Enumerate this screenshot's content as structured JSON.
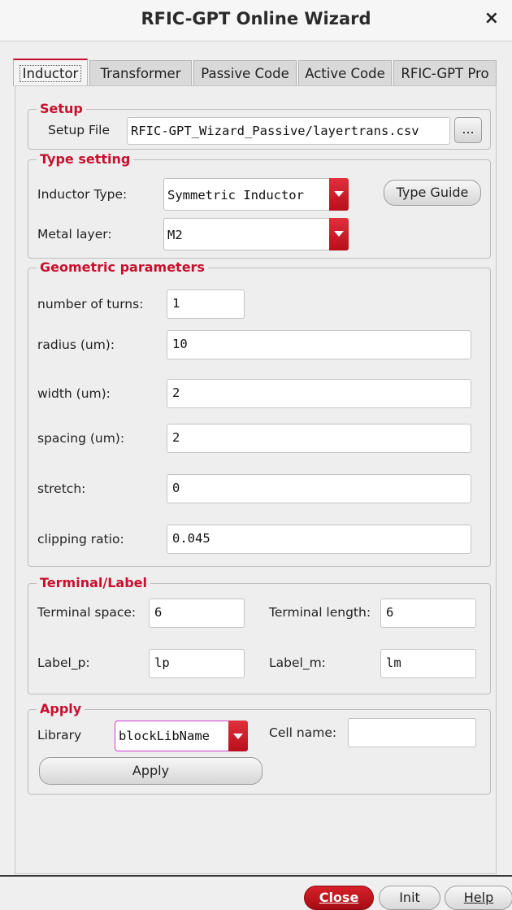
{
  "window": {
    "title": "RFIC-GPT Online Wizard",
    "close_glyph": "×"
  },
  "tabs": [
    {
      "label": "Inductor",
      "active": true
    },
    {
      "label": "Transformer",
      "active": false
    },
    {
      "label": "Passive Code",
      "active": false
    },
    {
      "label": "Active Code",
      "active": false
    },
    {
      "label": "RFIC-GPT Pro",
      "active": false
    }
  ],
  "setup": {
    "title": "Setup",
    "file_label": "Setup File",
    "file_value": "RFIC-GPT_Wizard_Passive/layertrans.csv",
    "browse_label": "..."
  },
  "type_setting": {
    "title": "Type setting",
    "inductor_type_label": "Inductor Type:",
    "inductor_type_value": "Symmetric Inductor",
    "type_guide_label": "Type Guide",
    "metal_layer_label": "Metal layer:",
    "metal_layer_value": "M2"
  },
  "geometric": {
    "title": "Geometric parameters",
    "turns_label": "number of turns:",
    "turns_value": "1",
    "radius_label": "radius (um):",
    "radius_value": "10",
    "width_label": "width (um):",
    "width_value": "2",
    "spacing_label": "spacing (um):",
    "spacing_value": "2",
    "stretch_label": "stretch:",
    "stretch_value": "0",
    "clipping_label": "clipping ratio:",
    "clipping_value": "0.045"
  },
  "terminal": {
    "title": "Terminal/Label",
    "space_label": "Terminal space:",
    "space_value": "6",
    "length_label": "Terminal length:",
    "length_value": "6",
    "label_p_label": "Label_p:",
    "label_p_value": "lp",
    "label_m_label": "Label_m:",
    "label_m_value": "lm"
  },
  "apply": {
    "title": "Apply",
    "library_label": "Library",
    "library_value": "blockLibName",
    "cell_name_label": "Cell name:",
    "cell_name_value": "",
    "apply_label": "Apply"
  },
  "footer": {
    "close_label": "Close",
    "init_label": "Init",
    "help_label": "Help"
  },
  "colors": {
    "accent": "#c8102e",
    "dropdown": "#c8102e"
  }
}
